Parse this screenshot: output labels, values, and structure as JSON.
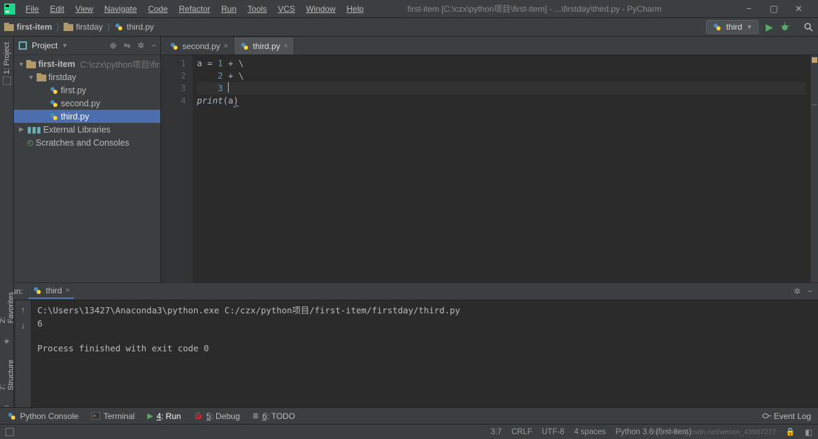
{
  "window": {
    "title": "first-item [C:\\czx\\python项目\\first-item] - ...\\firstday\\third.py - PyCharm"
  },
  "menu": {
    "file": "File",
    "edit": "Edit",
    "view": "View",
    "navigate": "Navigate",
    "code": "Code",
    "refactor": "Refactor",
    "run": "Run",
    "tools": "Tools",
    "vcs": "VCS",
    "window": "Window",
    "help": "Help"
  },
  "breadcrumbs": {
    "c0": "first-item",
    "c1": "firstday",
    "c2": "third.py"
  },
  "interpreter": {
    "name": "third"
  },
  "project_panel": {
    "title": "Project",
    "root": "first-item",
    "root_path": "C:\\czx\\python项目\\first",
    "folder1": "firstday",
    "file1": "first.py",
    "file2": "second.py",
    "file3": "third.py",
    "ext_lib": "External Libraries",
    "scratches": "Scratches and Consoles"
  },
  "tabs": {
    "t0": "second.py",
    "t1": "third.py"
  },
  "code": {
    "l1_a": "a ",
    "l1_eq": "= ",
    "l1_n": "1",
    "l1_op": " + \\",
    "l2_pad": "    ",
    "l2_n": "2",
    "l2_op": " + \\",
    "l3_pad": "    ",
    "l3_n": "3",
    "l3_sp": " ",
    "l4_fn": "print",
    "l4_p1": "(",
    "l4_var": "a",
    "l4_p2": ")"
  },
  "gutter": {
    "n1": "1",
    "n2": "2",
    "n3": "3",
    "n4": "4"
  },
  "run_header": {
    "label": "Run:",
    "tab": "third"
  },
  "console": {
    "l1": "C:\\Users\\13427\\Anaconda3\\python.exe C:/czx/python项目/first-item/firstday/third.py",
    "l2": "6",
    "l3": "Process finished with exit code 0"
  },
  "bottom_bar": {
    "console": "Python Console",
    "terminal": "Terminal",
    "run_u": "4",
    "run_t": ": Run",
    "debug_u": "5",
    "debug_t": ": Debug",
    "todo_u": "6",
    "todo_t": ": TODO",
    "event_log": "Event Log"
  },
  "left_strip": {
    "project_u": "1",
    "project_t": ": Project"
  },
  "left_strip2": {
    "fav_u": "2",
    "fav_t": ": Favorites",
    "str_u": "7",
    "str_t": ": Structure"
  },
  "status": {
    "pos": "3:7",
    "crlf": "CRLF",
    "enc": "UTF-8",
    "indent": "4 spaces",
    "interp": "Python 3.6 (first-item)",
    "watermark": "https://blog.csdn.net/weixin_43987277"
  }
}
